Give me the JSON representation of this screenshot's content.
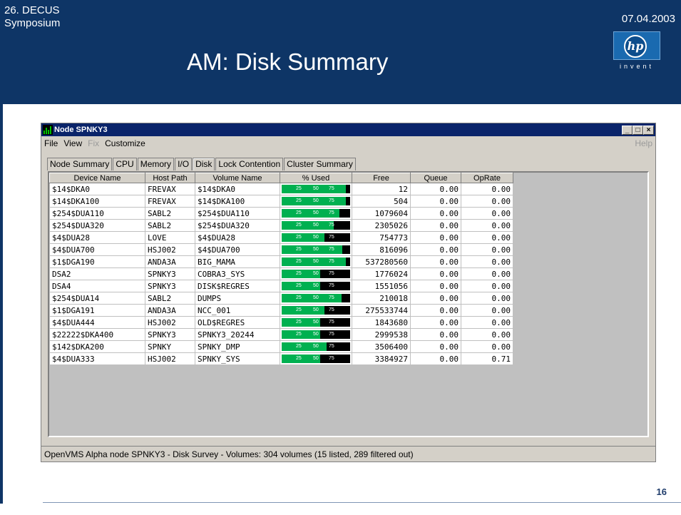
{
  "slide": {
    "header_line1": "26. DECUS",
    "header_line2": "Symposium",
    "date": "07.04.2003",
    "title": "AM: Disk Summary",
    "page_number": "16",
    "logo": {
      "mark": "hp",
      "tagline": "invent"
    }
  },
  "window": {
    "title": "Node SPNKY3",
    "controls": [
      "_",
      "□",
      "×"
    ]
  },
  "menu": {
    "file": "File",
    "view": "View",
    "fix": "Fix",
    "customize": "Customize",
    "help": "Help"
  },
  "tabs": [
    "Node Summary",
    "CPU",
    "Memory",
    "I/O",
    "Disk",
    "Lock Contention",
    "Cluster Summary"
  ],
  "active_tab": "Disk",
  "table": {
    "columns": [
      "Device Name",
      "Host Path",
      "Volume Name",
      "% Used",
      "Free",
      "Queue",
      "OpRate"
    ],
    "bar_ticks": [
      "25",
      "50",
      "75"
    ],
    "rows": [
      {
        "device": "$14$DKA0",
        "host": "FREVAX",
        "volume": "$14$DKA0",
        "used_pct": 94,
        "free": "12",
        "queue": "0.00",
        "oprate": "0.00"
      },
      {
        "device": "$14$DKA100",
        "host": "FREVAX",
        "volume": "$14$DKA100",
        "used_pct": 94,
        "free": "504",
        "queue": "0.00",
        "oprate": "0.00"
      },
      {
        "device": "$254$DUA110",
        "host": "SABL2",
        "volume": "$254$DUA110",
        "used_pct": 84,
        "free": "1079604",
        "queue": "0.00",
        "oprate": "0.00"
      },
      {
        "device": "$254$DUA320",
        "host": "SABL2",
        "volume": "$254$DUA320",
        "used_pct": 76,
        "free": "2305026",
        "queue": "0.00",
        "oprate": "0.00"
      },
      {
        "device": "$4$DUA28",
        "host": "LOVE",
        "volume": "$4$DUA28",
        "used_pct": 62,
        "free": "754773",
        "queue": "0.00",
        "oprate": "0.00"
      },
      {
        "device": "$4$DUA700",
        "host": "HSJ002",
        "volume": "$4$DUA700",
        "used_pct": 89,
        "free": "816096",
        "queue": "0.00",
        "oprate": "0.00"
      },
      {
        "device": "$1$DGA190",
        "host": "ANDA3A",
        "volume": "BIG_MAMA",
        "used_pct": 94,
        "free": "537280560",
        "queue": "0.00",
        "oprate": "0.00"
      },
      {
        "device": "DSA2",
        "host": "SPNKY3",
        "volume": "COBRA3_SYS",
        "used_pct": 56,
        "free": "1776024",
        "queue": "0.00",
        "oprate": "0.00"
      },
      {
        "device": "DSA4",
        "host": "SPNKY3",
        "volume": "DISK$REGRES",
        "used_pct": 56,
        "free": "1551056",
        "queue": "0.00",
        "oprate": "0.00"
      },
      {
        "device": "$254$DUA14",
        "host": "SABL2",
        "volume": "DUMPS",
        "used_pct": 88,
        "free": "210018",
        "queue": "0.00",
        "oprate": "0.00"
      },
      {
        "device": "$1$DGA191",
        "host": "ANDA3A",
        "volume": "NCC_001",
        "used_pct": 62,
        "free": "275533744",
        "queue": "0.00",
        "oprate": "0.00"
      },
      {
        "device": "$4$DUA444",
        "host": "HSJ002",
        "volume": "OLD$REGRES",
        "used_pct": 56,
        "free": "1843680",
        "queue": "0.00",
        "oprate": "0.00"
      },
      {
        "device": "$22222$DKA400",
        "host": "SPNKY3",
        "volume": "SPNKY3_20244",
        "used_pct": 56,
        "free": "2999538",
        "queue": "0.00",
        "oprate": "0.00"
      },
      {
        "device": "$142$DKA200",
        "host": "SPNKY",
        "volume": "SPNKY_DMP",
        "used_pct": 66,
        "free": "3506400",
        "queue": "0.00",
        "oprate": "0.00"
      },
      {
        "device": "$4$DUA333",
        "host": "HSJ002",
        "volume": "SPNKY_SYS",
        "used_pct": 56,
        "free": "3384927",
        "queue": "0.00",
        "oprate": "0.71"
      }
    ]
  },
  "status": "OpenVMS Alpha node SPNKY3 - Disk Survey - Volumes:  304 volumes (15 listed, 289 filtered out)",
  "colors": {
    "header_bg": "#0e3566",
    "bar_fill": "#00b050",
    "titlebar": "#0a246a",
    "window_bg": "#d4d0c8"
  }
}
